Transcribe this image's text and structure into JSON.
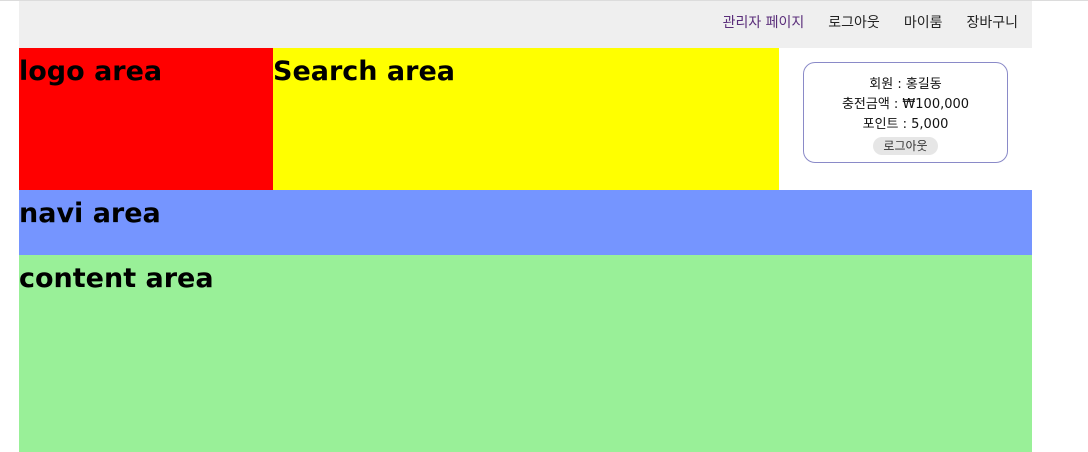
{
  "topbar": {
    "links": [
      {
        "label": "관리자 페이지",
        "visited": true
      },
      {
        "label": "로그아웃",
        "visited": false
      },
      {
        "label": "마이룸",
        "visited": false
      },
      {
        "label": "장바구니",
        "visited": false
      }
    ]
  },
  "areas": {
    "logo": "logo area",
    "search": "Search area",
    "navi": "navi area",
    "content": "content area"
  },
  "member": {
    "name_line": "회원 : 홍길동",
    "charge_line": "충전금액 : ₩100,000",
    "point_line": "포인트 : 5,000",
    "logout_label": "로그아웃"
  },
  "colors": {
    "topbar_bg": "#efefef",
    "logo_bg": "#ff0000",
    "search_bg": "#ffff00",
    "navi_bg": "#7595ff",
    "content_bg": "#99f098",
    "member_border": "#8a8ac8"
  }
}
